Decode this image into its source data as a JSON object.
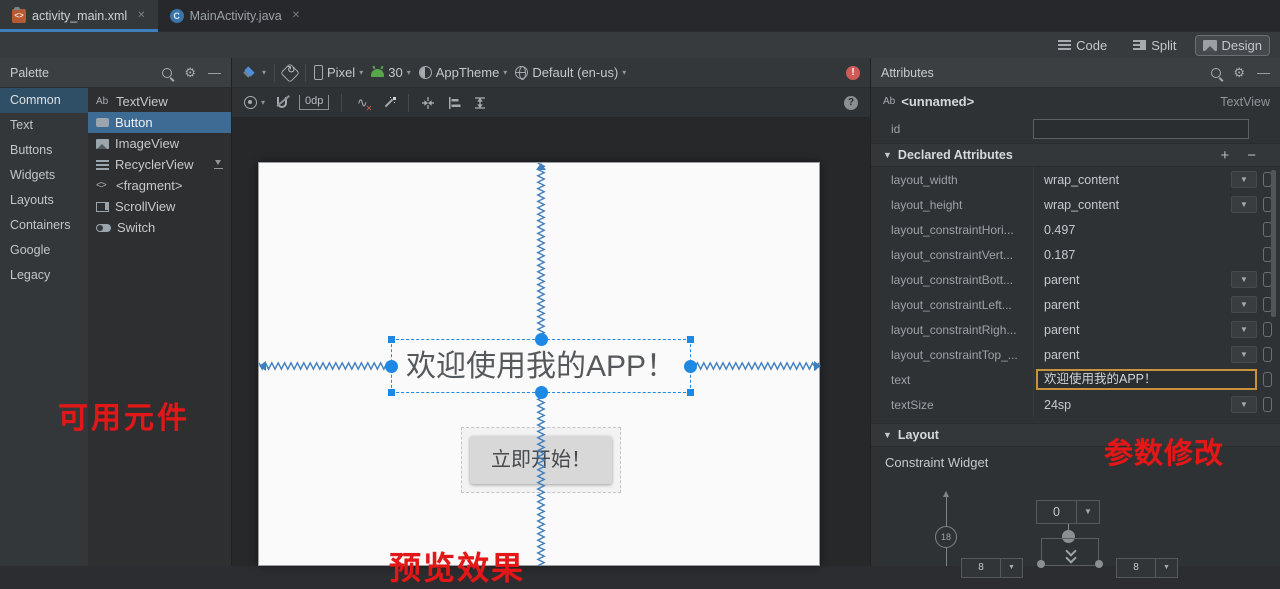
{
  "tabs": [
    {
      "label": "activity_main.xml",
      "active": true
    },
    {
      "label": "MainActivity.java",
      "active": false
    }
  ],
  "view_modes": {
    "code": "Code",
    "split": "Split",
    "design": "Design",
    "selected": "Design"
  },
  "palette": {
    "title": "Palette",
    "categories": [
      "Common",
      "Text",
      "Buttons",
      "Widgets",
      "Layouts",
      "Containers",
      "Google",
      "Legacy"
    ],
    "selected_category": "Common",
    "items": [
      "TextView",
      "Button",
      "ImageView",
      "RecyclerView",
      "<fragment>",
      "ScrollView",
      "Switch"
    ],
    "selected_item": "Button",
    "textview_icon": "Ab",
    "fragment_icon": "<>"
  },
  "design_toolbar": {
    "device": "Pixel",
    "api_level": "30",
    "theme": "AppTheme",
    "locale": "Default (en-us)",
    "default_margin": "0dp"
  },
  "canvas": {
    "textview_text": "欢迎使用我的APP！",
    "button_text": "立即开始！"
  },
  "annotations": {
    "palette_note": "可用元件",
    "attrs_note": "参数修改",
    "preview_note": "预览效果"
  },
  "attributes": {
    "title": "Attributes",
    "component_icon": "Ab",
    "component_name": "<unnamed>",
    "component_type": "TextView",
    "id_label": "id",
    "id_value": "",
    "declared_header": "Declared Attributes",
    "rows": [
      {
        "label": "layout_width",
        "value": "wrap_content"
      },
      {
        "label": "layout_height",
        "value": "wrap_content"
      },
      {
        "label": "layout_constraintHori...",
        "value": "0.497"
      },
      {
        "label": "layout_constraintVert...",
        "value": "0.187"
      },
      {
        "label": "layout_constraintBott...",
        "value": "parent"
      },
      {
        "label": "layout_constraintLeft...",
        "value": "parent"
      },
      {
        "label": "layout_constraintRigh...",
        "value": "parent"
      },
      {
        "label": "layout_constraintTop_...",
        "value": "parent"
      },
      {
        "label": "text",
        "value": "欢迎使用我的APP！"
      },
      {
        "label": "textSize",
        "value": "24sp"
      }
    ],
    "layout_header": "Layout",
    "constraint_widget_label": "Constraint Widget",
    "margin_top": "0",
    "bias_value": "18",
    "margin_left": "8",
    "margin_right": "8"
  },
  "icons": {
    "close": "✕",
    "gear": "⚙",
    "minimize": "—",
    "dropdown": "▼",
    "caret": "▾",
    "plus": "+",
    "minus": "−",
    "error": "!",
    "help": "?",
    "clear_constraints": "∿",
    "clear_constraints_x": "✕"
  },
  "colors": {
    "accent_blue": "#3d7ebd",
    "selection_blue": "#1e88e5",
    "zigzag_blue": "#3f7fbe",
    "annotation_red": "#e31717",
    "error_red": "#cf5b56",
    "focus_orange": "#c8923f",
    "android_green": "#57a64b"
  }
}
